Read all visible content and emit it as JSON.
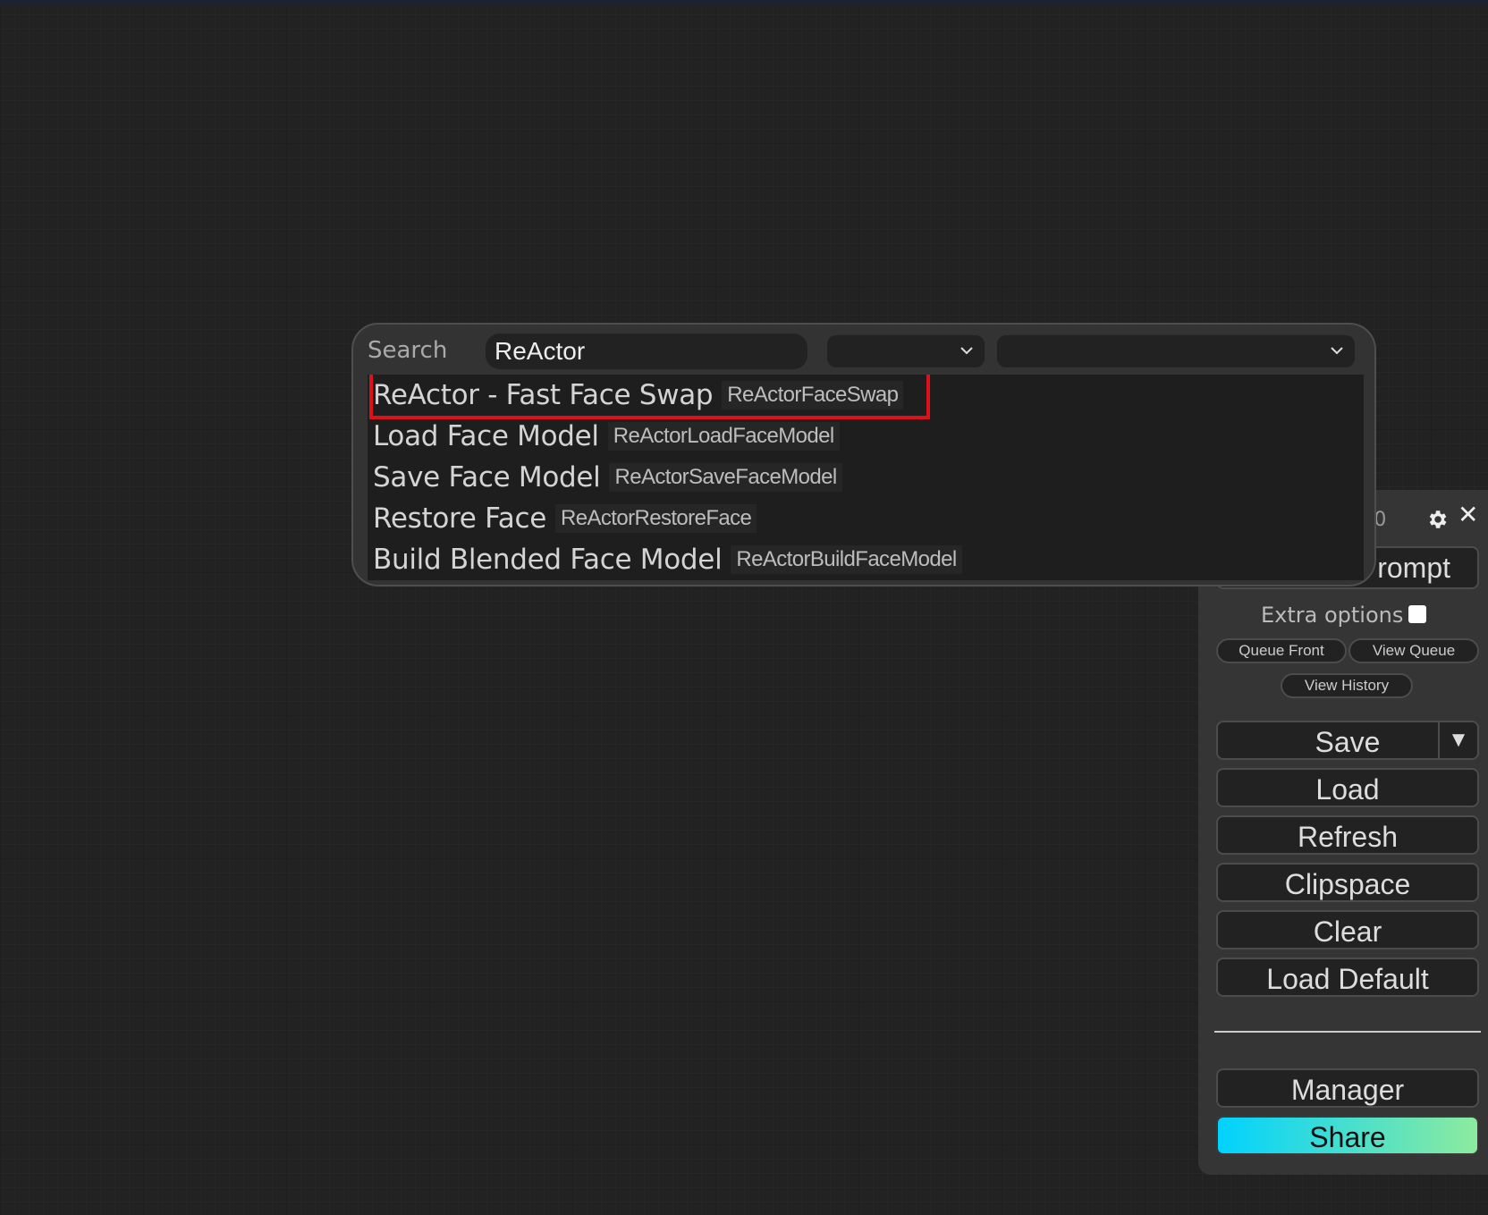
{
  "search_dialog": {
    "label": "Search",
    "query": "ReActor",
    "filter_1_value": "",
    "filter_2_value": "",
    "results": [
      {
        "name": "ReActor - Fast Face Swap",
        "type": "ReActorFaceSwap",
        "selected": true
      },
      {
        "name": "Load Face Model",
        "type": "ReActorLoadFaceModel"
      },
      {
        "name": "Save Face Model",
        "type": "ReActorSaveFaceModel"
      },
      {
        "name": "Restore Face",
        "type": "ReActorRestoreFace"
      },
      {
        "name": "Build Blended Face Model",
        "type": "ReActorBuildFaceModel"
      }
    ]
  },
  "menu": {
    "queue_size": ": 0",
    "close_glyph": "✕",
    "queue_button": "rompt",
    "extra_options_label": "Extra options",
    "extra_options_checked": false,
    "queue_front": "Queue Front",
    "view_queue": "View Queue",
    "view_history": "View History",
    "save": "Save",
    "save_arrow": "▼",
    "load": "Load",
    "refresh": "Refresh",
    "clipspace": "Clipspace",
    "clear": "Clear",
    "load_default": "Load Default",
    "manager": "Manager",
    "share": "Share"
  },
  "colors": {
    "canvas_bg": "#222222",
    "panel_bg": "#353535",
    "selection_outline": "#e0101a",
    "share_gradient_start": "#00d2ff",
    "share_gradient_end": "#8deb9d"
  }
}
